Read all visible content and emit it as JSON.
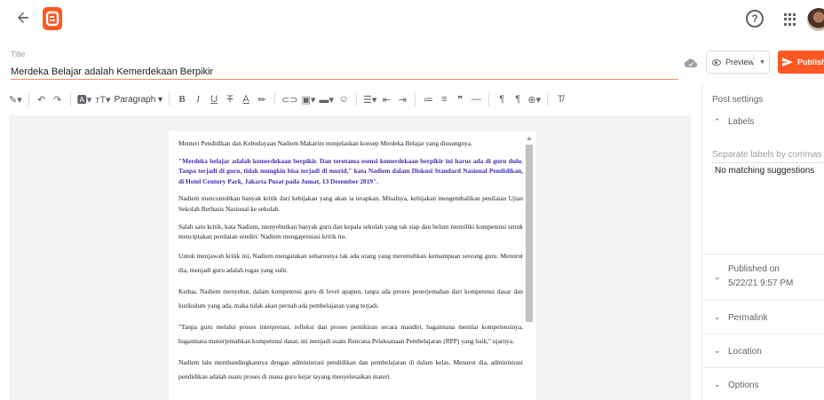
{
  "header": {
    "back_icon": "arrow-left-icon",
    "logo_icon": "blogger-logo-icon",
    "help_icon": "help-circle-icon",
    "apps_icon": "apps-grid-icon"
  },
  "post": {
    "title_label": "Title",
    "title_value": "Merdeka Belajar adalah Kemerdekaan Berpikir"
  },
  "actions": {
    "preview_label": "Preview",
    "publish_label": "Publish"
  },
  "toolbar": {
    "paragraph_label": "Paragraph"
  },
  "body": {
    "paragraphs": [
      "Menteri Pendidikan dan Kebudayaan Nadiem Makarim menjelaskan konsep Merdeka Belajar yang diusungnya.",
      "\"Merdeka belajar adalah kemerdekaan berpikir. Dan terutama esensi kemerdekaan berpikir ini harus ada di guru dulu. Tanpa terjadi di guru, tidak mungkin bisa terjadi di murid,\" kata Nadiem dalam Diskusi Standard Nasional Pendidikan, di Hotel Century Park, Jakarta Pusat pada Jumat, 13 Desember 2019\".",
      "Nadiem mencontohkan banyak kritik dari kebijakan yang akan ia terapkan. Misalnya, kebijakan mengembalikan penilaian Ujian Sekolah Berbasis Nasional ke sekolah.",
      "Salah satu kritik, kata Nadiem, menyebutkan banyak guru dan kepala sekolah yang tak siap dan belum memiliki kompetensi untuk menciptakan penilaian sendiri. Nadiem mengapresiasi kritik itu.",
      "Untuk menjawab kritik ini, Nadiem mengatakan seharusnya tak ada orang yang meremehkan kemampuan seorang guru. Menurut dia, menjadi guru adalah tugas yang sulit.",
      "Kedua, Nadiem menyebut, dalam kompetensi guru di level apapun, tanpa ada proses penerjemahan dari kompetensi dasar dan kurikulum yang ada, maka tidak akan pernah ada pembelajaran yang terjadi.",
      "\"Tanpa guru melalui proses interpretasi, refleksi dan proses pemikiran secara mandiri, bagaimana menilai kompetensinya, bagaimana menerjemahkan kompetensi dasar, ini menjadi suatu Rencana Pelaksanaan Pembelajaran (RPP) yang baik,\" ujarnya.",
      "Nadiem lalu membandingkannya dengan administrasi pendidikan dan pembelajaran di dalam kelas. Menurut dia, administrasi pendidikan adalah suatu proses di mana guru kejar tayang menyelesaikan materi."
    ]
  },
  "sidebar": {
    "post_settings_label": "Post settings",
    "labels_label": "Labels",
    "labels_placeholder": "Separate labels by commas",
    "no_matching": "No matching suggestions",
    "published_label": "Published on",
    "published_date": "5/22/21 9:57 PM",
    "permalink_label": "Permalink",
    "location_label": "Location",
    "options_label": "Options"
  },
  "colors": {
    "accent": "#ff5722",
    "quote_text": "#3a2fb0",
    "spellcheck": "#d93025"
  }
}
